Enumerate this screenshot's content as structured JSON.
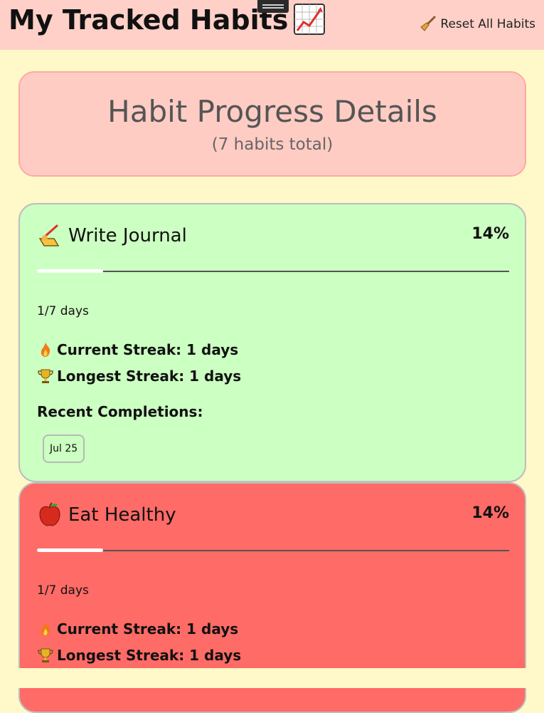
{
  "header": {
    "title": "My Tracked Habits",
    "title_icon": "chart-increasing-icon",
    "reset_label": "Reset All Habits",
    "reset_icon": "broom-icon"
  },
  "summary": {
    "title": "Habit Progress Details",
    "subtitle": "(7 habits total)"
  },
  "habits": [
    {
      "name": "Write Journal",
      "icon": "writing-hand-icon",
      "percent_label": "14%",
      "progress": 0.14,
      "days": "1/7 days",
      "current_streak": "Current Streak: 1 days",
      "longest_streak": "Longest Streak: 1 days",
      "recent_label": "Recent Completions:",
      "recent_dates": [
        "Jul 25"
      ],
      "bg_color": "#ccffc2"
    },
    {
      "name": "Eat Healthy",
      "icon": "apple-icon",
      "percent_label": "14%",
      "progress": 0.14,
      "days": "1/7 days",
      "current_streak": "Current Streak: 1 days",
      "longest_streak": "Longest Streak: 1 days",
      "bg_color": "#ff6b66"
    }
  ],
  "colors": {
    "page_bg": "#fff8c8",
    "header_bg": "#ffd0c8",
    "summary_bg": "#ffccc4",
    "progress_fill": "#ffffff",
    "progress_track": "#555555"
  }
}
